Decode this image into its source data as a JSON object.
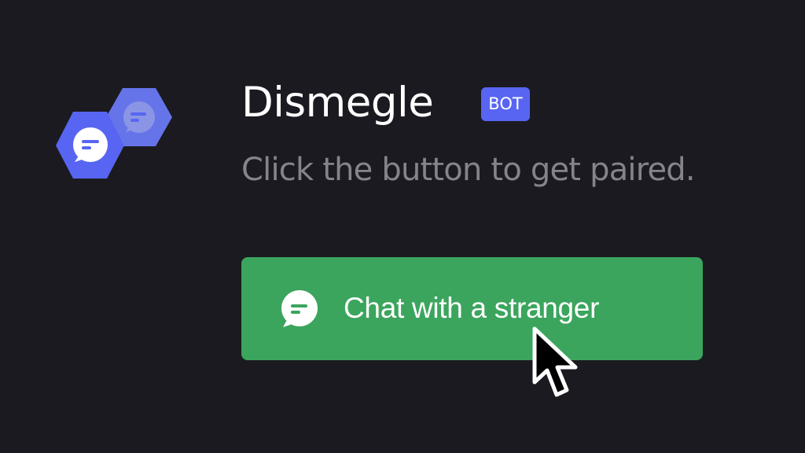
{
  "bot": {
    "name": "Dismegle",
    "badge": "BOT",
    "subtitle": "Click the button to get paired.",
    "avatar_icon": "chat-bubbles-hexagon-icon"
  },
  "action": {
    "label": "Chat with a stranger",
    "icon": "chat-bubble-icon"
  },
  "colors": {
    "background": "#1b1a20",
    "button": "#3ba55d",
    "badge": "#5865f2",
    "avatar_primary": "#5865f2",
    "avatar_secondary": "#6e7ae8",
    "subtitle_text": "#85848b"
  }
}
